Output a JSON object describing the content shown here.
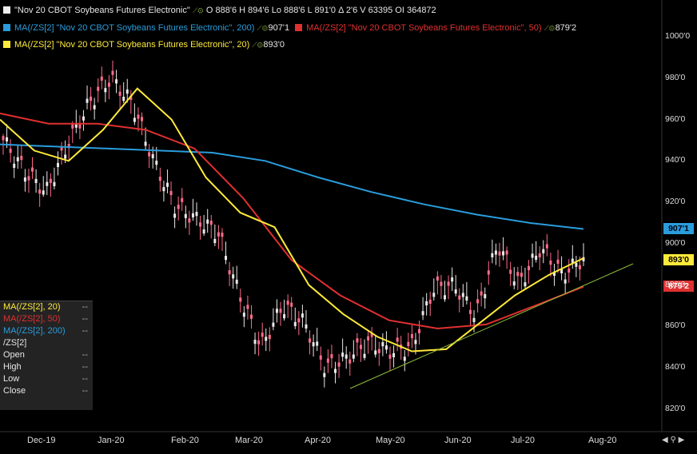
{
  "header": {
    "symbol_line": "\"Nov 20 CBOT Soybeans Futures Electronic\"",
    "ohlc": "O 888'6  H 894'6  Lo 888'6  L 891'0  Δ 2'6  V 63395  OI 364872",
    "ma200_label": "MA(/ZS[2] \"Nov 20 CBOT Soybeans Futures Electronic\", 200)",
    "ma200_value": "907'1",
    "ma50_label": "MA(/ZS[2] \"Nov 20 CBOT Soybeans Futures Electronic\", 50)",
    "ma50_value": "879'2",
    "ma20_label": "MA(/ZS[2] \"Nov 20 CBOT Soybeans Futures Electronic\", 20)",
    "ma20_value": "893'0"
  },
  "legend_box": {
    "rows": [
      {
        "label": "MA(/ZS[2], 20)",
        "value": "--",
        "color": "#ffea3a"
      },
      {
        "label": "MA(/ZS[2], 50)",
        "value": "--",
        "color": "#e03030"
      },
      {
        "label": "MA(/ZS[2], 200)",
        "value": "--",
        "color": "#2a9ddc"
      },
      {
        "label": "/ZS[2]",
        "value": "",
        "color": "#e6e6e6"
      },
      {
        "label": "Open",
        "value": "--",
        "color": "#e6e6e6"
      },
      {
        "label": "High",
        "value": "--",
        "color": "#e6e6e6"
      },
      {
        "label": "Low",
        "value": "--",
        "color": "#e6e6e6"
      },
      {
        "label": "Close",
        "value": "--",
        "color": "#e6e6e6"
      }
    ]
  },
  "badges": {
    "ma200": "907'1",
    "price": "893'0",
    "ma50": "879'2"
  },
  "colors": {
    "background": "#000000",
    "up_candle": "#e8e8e8",
    "down_candle": "#ff6b8a",
    "ma20": "#ffea3a",
    "ma50": "#e03030",
    "ma200": "#2a9ddc",
    "trendline": "#8fbf3a"
  },
  "chart_data": {
    "type": "line",
    "title": "\"Nov 20 CBOT Soybeans Futures Electronic\"",
    "x": [
      "Dec-19",
      "Jan-20",
      "Feb-20",
      "Mar-20",
      "Apr-20",
      "May-20",
      "Jun-20",
      "Jul-20",
      "Aug-20"
    ],
    "price_ticks": [
      "1000'0",
      "980'0",
      "960'0",
      "940'0",
      "920'0",
      "900'0",
      "880'0",
      "860'0",
      "840'0",
      "820'0"
    ],
    "ylim": [
      815,
      1005
    ],
    "series": [
      {
        "name": "MA(/ZS[2] \"Nov 20 CBOT Soybeans Futures Electronic\", 200)",
        "color": "#2a9ddc",
        "values": [
          948,
          947,
          946,
          945,
          944,
          940,
          932,
          925,
          919,
          914,
          910,
          907.1
        ]
      },
      {
        "name": "MA(/ZS[2] \"Nov 20 CBOT Soybeans Futures Electronic\", 50)",
        "color": "#e03030",
        "values": [
          963,
          958,
          958,
          955,
          946,
          922,
          892,
          875,
          863,
          859,
          861,
          870,
          879.2
        ]
      },
      {
        "name": "MA(/ZS[2] \"Nov 20 CBOT Soybeans Futures Electronic\", 20)",
        "color": "#ffea3a",
        "values": [
          960,
          945,
          940,
          955,
          975,
          960,
          932,
          915,
          908,
          880,
          866,
          855,
          848,
          849,
          862,
          875,
          885,
          893
        ]
      },
      {
        "name": "/ZS[2]",
        "color": "#e8e8e8",
        "values": [
          950,
          935,
          925,
          948,
          968,
          980,
          968,
          940,
          918,
          912,
          905,
          875,
          850,
          870,
          862,
          840,
          845,
          852,
          848,
          850,
          878,
          880,
          865,
          900,
          880,
          898,
          885,
          893
        ]
      }
    ],
    "grid": false
  }
}
